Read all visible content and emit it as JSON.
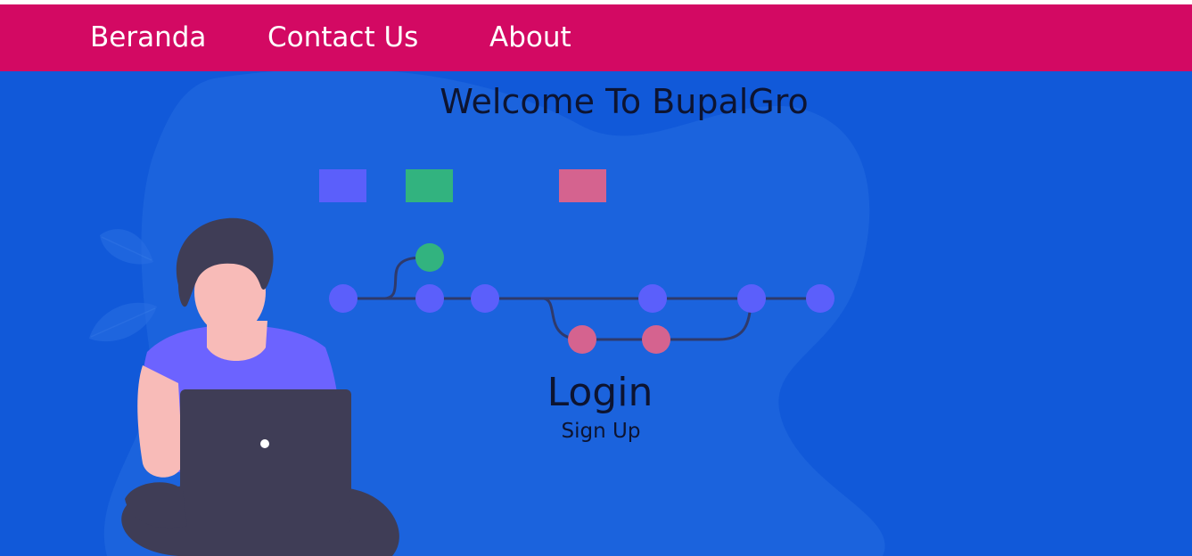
{
  "nav": {
    "items": [
      {
        "label": "Beranda"
      },
      {
        "label": "Contact Us"
      },
      {
        "label": "About"
      }
    ]
  },
  "hero": {
    "title": "Welcome To BupalGro",
    "login_label": "Login",
    "signup_label": "Sign Up"
  },
  "colors": {
    "navbar": "#d30963",
    "hero_background": "#1159d9",
    "text_dark": "#0d1431",
    "node_blue": "#5b5ffb",
    "node_green": "#32b37f",
    "node_pink": "#d5638f"
  },
  "illustration": {
    "name": "person-with-laptop",
    "diagram": "git-branch-graph"
  }
}
